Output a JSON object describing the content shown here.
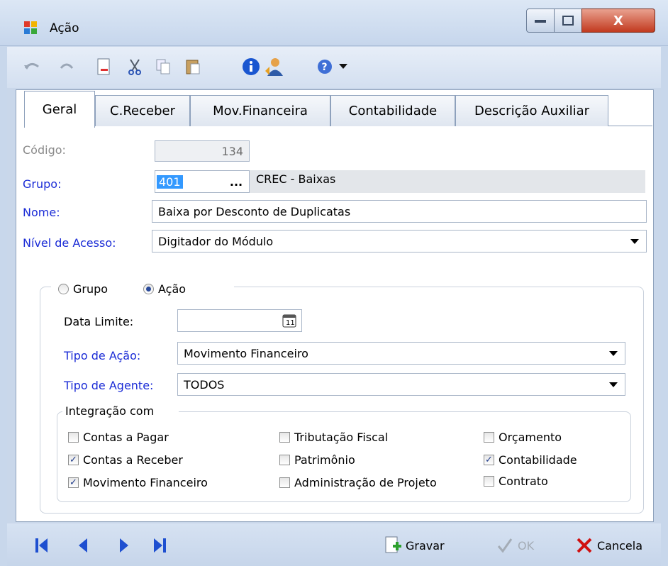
{
  "window": {
    "title": "Ação",
    "close_glyph": "X"
  },
  "toolbar": {
    "items": [
      "undo-icon",
      "redo-icon",
      "new-document-icon",
      "cut-icon",
      "copy-icon",
      "paste-icon",
      "info-icon",
      "user-icon",
      "help-icon",
      "dropdown-arrow-icon"
    ]
  },
  "tabs": [
    {
      "label": "Geral",
      "active": true
    },
    {
      "label": "C.Receber"
    },
    {
      "label": "Mov.Financeira"
    },
    {
      "label": "Contabilidade"
    },
    {
      "label": "Descrição Auxiliar"
    }
  ],
  "form": {
    "codigo": {
      "label": "Código:",
      "value": "134"
    },
    "grupo": {
      "label": "Grupo:",
      "value": "401",
      "lookup_label": "...",
      "description": "CREC - Baixas"
    },
    "nome": {
      "label": "Nome:",
      "value": "Baixa por Desconto de Duplicatas"
    },
    "nivel_acesso": {
      "label": "Nível de Acesso:",
      "value": "Digitador do Módulo"
    }
  },
  "scope": {
    "options": [
      {
        "label": "Grupo",
        "selected": false
      },
      {
        "label": "Ação",
        "selected": true
      }
    ],
    "data_limite": {
      "label": "Data Limite:",
      "value": ""
    },
    "tipo_acao": {
      "label": "Tipo de Ação:",
      "value": "Movimento Financeiro"
    },
    "tipo_agente": {
      "label": "Tipo de Agente:",
      "value": "TODOS"
    }
  },
  "integracao": {
    "title": "Integração com",
    "items": [
      {
        "label": "Contas a Pagar",
        "checked": false
      },
      {
        "label": "Contas a Receber",
        "checked": true
      },
      {
        "label": "Movimento Financeiro",
        "checked": true
      },
      {
        "label": "Tributação Fiscal",
        "checked": false
      },
      {
        "label": "Patrimônio",
        "checked": false
      },
      {
        "label": "Administração de Projeto",
        "checked": false
      },
      {
        "label": "Orçamento",
        "checked": false
      },
      {
        "label": "Contabilidade",
        "checked": true
      },
      {
        "label": "Contrato",
        "checked": false
      }
    ]
  },
  "footer": {
    "gravar": "Gravar",
    "ok": "OK",
    "cancela": "Cancela"
  },
  "colors": {
    "label_blue": "#1a2bd6",
    "label_grey": "#8a8a8a",
    "cancel_red": "#d01010",
    "nav_blue": "#1e4fd0"
  }
}
